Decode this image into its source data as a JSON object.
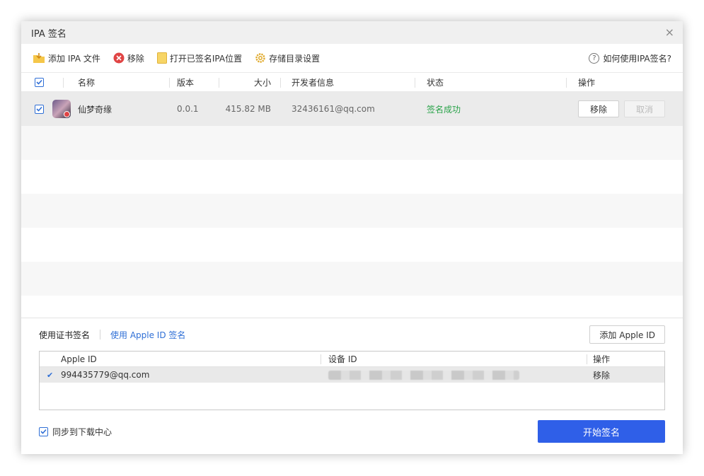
{
  "window": {
    "title": "IPA 签名",
    "close_glyph": "×"
  },
  "toolbar": {
    "add_label": "添加 IPA 文件",
    "remove_label": "移除",
    "open_label": "打开已签名IPA位置",
    "storage_label": "存储目录设置",
    "help_label": "如何使用IPA签名?"
  },
  "grid": {
    "headers": {
      "name": "名称",
      "version": "版本",
      "size": "大小",
      "developer": "开发者信息",
      "status": "状态",
      "action": "操作"
    },
    "rows": [
      {
        "checked": true,
        "name": "仙梦奇缘",
        "version": "0.0.1",
        "size": "415.82 MB",
        "developer": "32436161@qq.com",
        "status": "签名成功",
        "remove_label": "移除",
        "cancel_label": "取消"
      }
    ]
  },
  "sign": {
    "tab_cert": "使用证书签名",
    "tab_appleid": "使用 Apple ID 签名",
    "add_appleid_label": "添加 Apple ID",
    "table": {
      "headers": {
        "apple_id": "Apple ID",
        "device_id": "设备 ID",
        "action": "操作"
      },
      "rows": [
        {
          "selected": true,
          "apple_id": "994435779@qq.com",
          "device_id_masked": true,
          "action": "移除"
        }
      ]
    }
  },
  "footer": {
    "sync_label": "同步到下载中心",
    "sync_checked": true,
    "start_label": "开始签名"
  },
  "colors": {
    "accent": "#2f5fe8",
    "link": "#2f6fd6",
    "success": "#2aa34a",
    "remove_icon": "#e04444",
    "folder_icon": "#f5c74a"
  }
}
